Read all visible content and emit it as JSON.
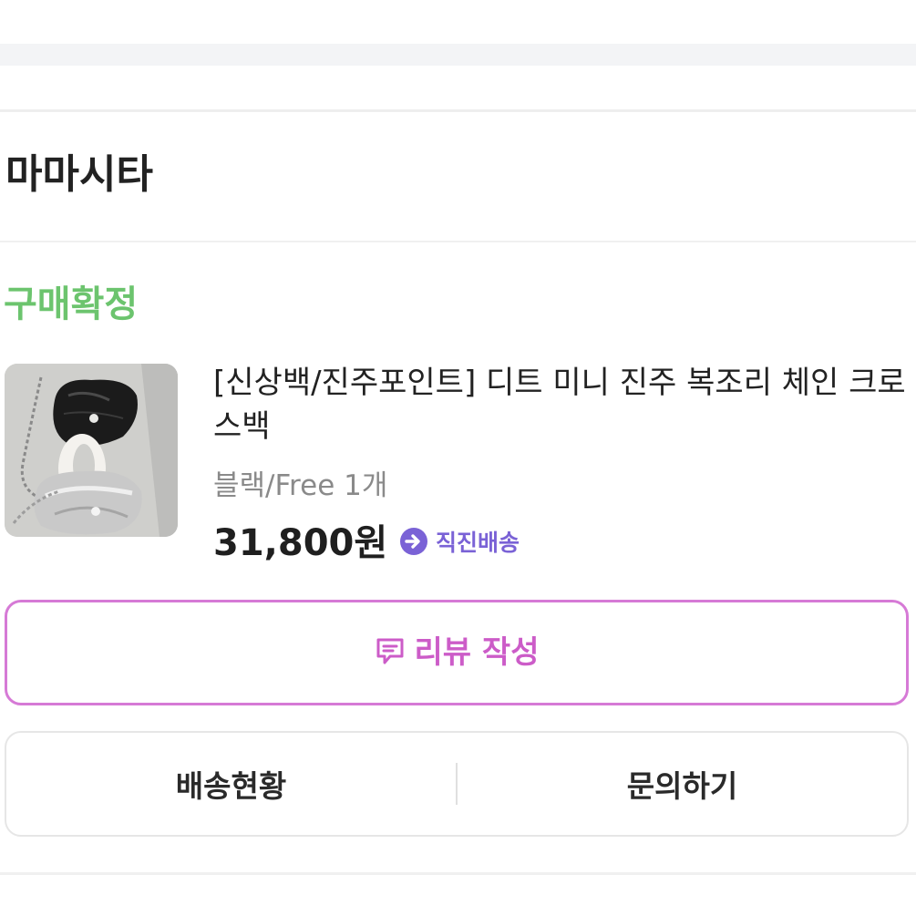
{
  "order": {
    "store_name": "마마시타",
    "status": "구매확정",
    "product": {
      "title": "[신상백/진주포인트] 디트 미니 진주 복조리 체인 크로스백",
      "option": "블랙/Free 1개",
      "price": "31,800원",
      "shipping_badge": "직진배송",
      "thumbnail_alt": "black and silver pearl chain bags"
    },
    "buttons": {
      "review": "리뷰 작성",
      "shipping_status": "배송현황",
      "inquiry": "문의하기"
    }
  },
  "colors": {
    "status_green": "#6cc46e",
    "review_pink": "#cc5cc8",
    "shipping_purple": "#7a62d6"
  }
}
